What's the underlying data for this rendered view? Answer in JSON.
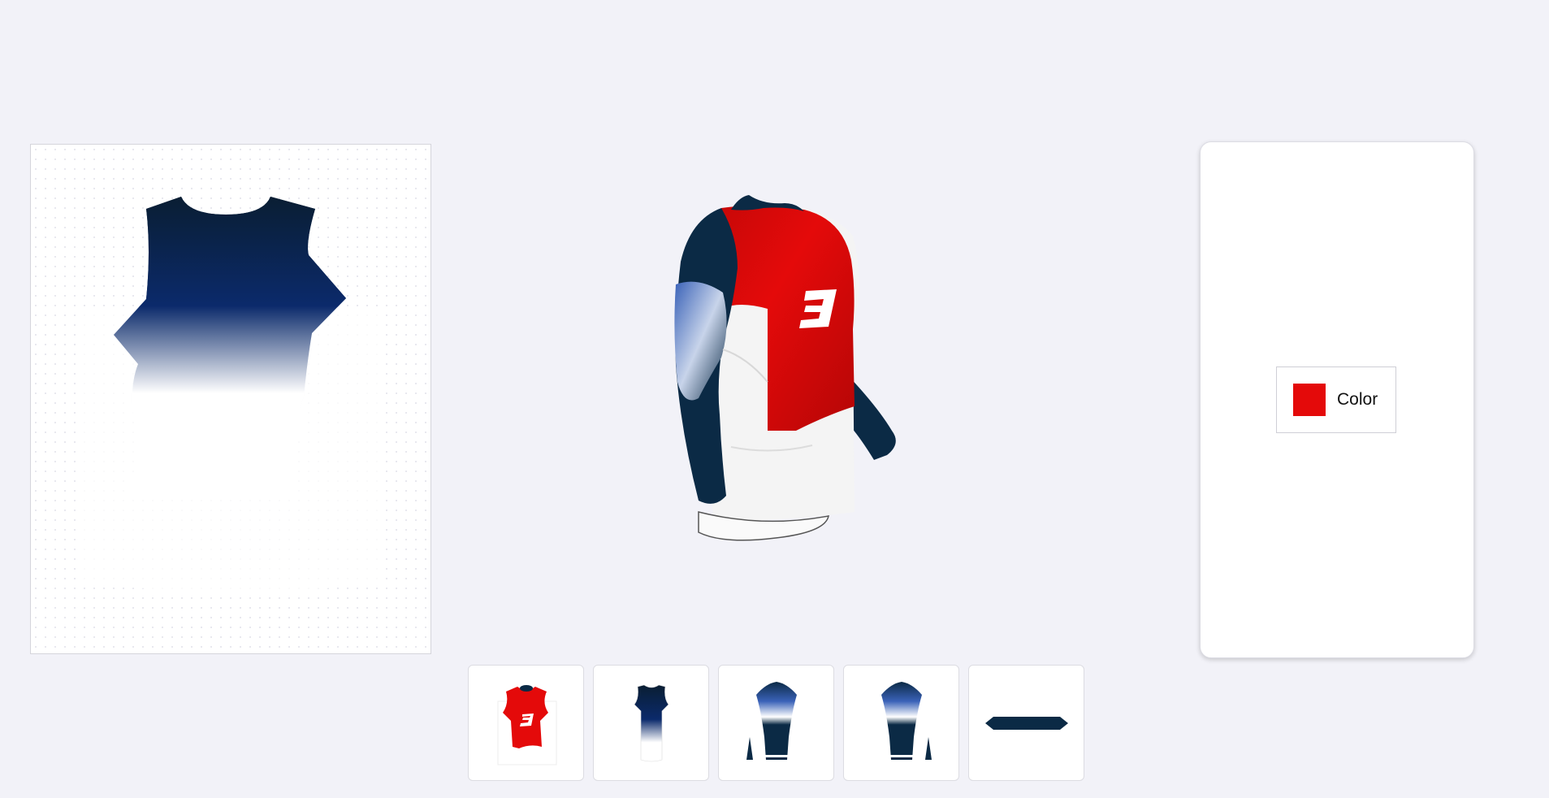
{
  "editor": {
    "pattern_panel": {
      "piece": "front-body",
      "gradient_colors": [
        "#0a1e33",
        "#0b2a6b",
        "#ffffff"
      ]
    },
    "model_view": {
      "garment": "long-sleeve-jersey",
      "colors": {
        "red": "#e30a0a",
        "navy": "#0b2a45",
        "white": "#ffffff"
      }
    },
    "properties": {
      "color_label": "Color",
      "color_value": "#e40a0a"
    },
    "thumbnails": [
      {
        "name": "front-panel",
        "selected": false
      },
      {
        "name": "back-panel",
        "selected": false
      },
      {
        "name": "left-sleeve",
        "selected": false
      },
      {
        "name": "right-sleeve",
        "selected": false
      },
      {
        "name": "collar",
        "selected": false
      }
    ]
  }
}
